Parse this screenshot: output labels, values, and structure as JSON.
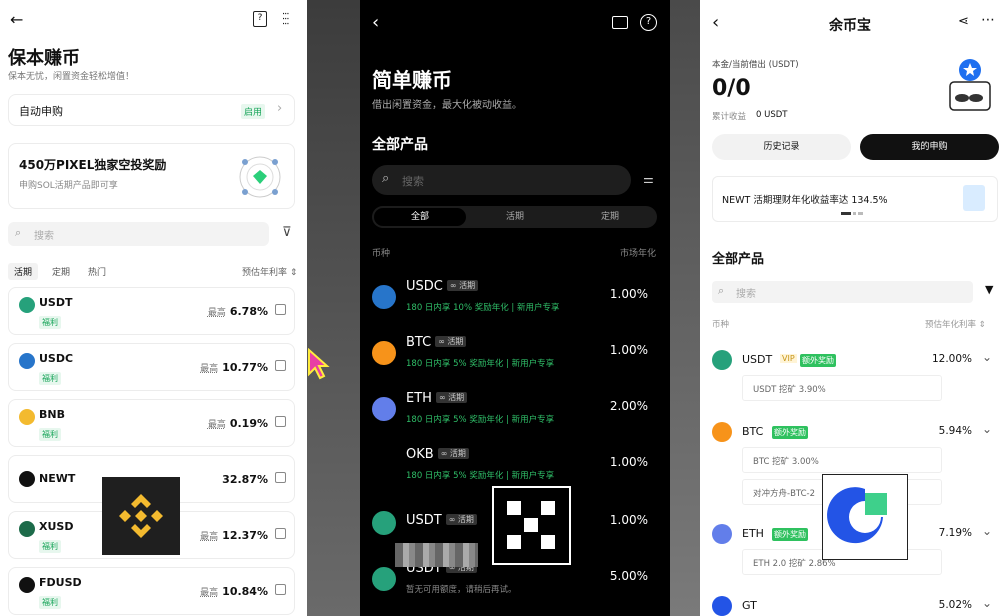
{
  "binance": {
    "title": "保本赚币",
    "subtitle": "保本无忧，闲置资金轻松增值！",
    "auto_subscribe": {
      "label": "自动申购",
      "status": "启用"
    },
    "promo": {
      "title": "450万PIXEL独家空投奖励",
      "desc": "申购SOL活期产品即可享"
    },
    "search_placeholder": "搜索",
    "tabs": [
      "活期",
      "定期",
      "热门"
    ],
    "sort_label": "预估年利率 ⇕",
    "rows": [
      {
        "symbol": "USDT",
        "tag": "福利",
        "prefix": "最高",
        "rate": "6.78%",
        "color": "#26a17b",
        "icon": "usdt-coin-icon"
      },
      {
        "symbol": "USDC",
        "tag": "福利",
        "prefix": "最高",
        "rate": "10.77%",
        "color": "#2775ca",
        "icon": "usdc-coin-icon"
      },
      {
        "symbol": "BNB",
        "tag": "福利",
        "prefix": "最高",
        "rate": "0.19%",
        "color": "#f3ba2f",
        "icon": "bnb-coin-icon"
      },
      {
        "symbol": "NEWT",
        "tag": "",
        "prefix": "",
        "rate": "32.87%",
        "color": "#111111",
        "icon": "newt-coin-icon"
      },
      {
        "symbol": "XUSD",
        "tag": "福利",
        "prefix": "最高",
        "rate": "12.37%",
        "color": "#1d6b4a",
        "icon": "xusd-coin-icon"
      },
      {
        "symbol": "FDUSD",
        "tag": "福利",
        "prefix": "最高",
        "rate": "10.84%",
        "color": "#111111",
        "icon": "fdusd-coin-icon"
      }
    ]
  },
  "okx": {
    "title": "简单赚币",
    "subtitle": "借出闲置资金，最大化被动收益。",
    "section": "全部产品",
    "search_placeholder": "搜索",
    "tabs": [
      "全部",
      "活期",
      "定期"
    ],
    "col_left": "币种",
    "col_right": "市场年化",
    "rows": [
      {
        "symbol": "USDC",
        "tag": "∞ 活期",
        "sub": "180 日内享 10% 奖励年化 | 新用户专享",
        "rate": "1.00%",
        "color": "#2775ca",
        "icon": "usdc-coin-icon"
      },
      {
        "symbol": "BTC",
        "tag": "∞ 活期",
        "sub": "180 日内享 5% 奖励年化 | 新用户专享",
        "rate": "1.00%",
        "color": "#f7931a",
        "icon": "btc-coin-icon"
      },
      {
        "symbol": "ETH",
        "tag": "∞ 活期",
        "sub": "180 日内享 5% 奖励年化 | 新用户专享",
        "rate": "2.00%",
        "color": "#627eea",
        "icon": "eth-coin-icon"
      },
      {
        "symbol": "OKB",
        "tag": "∞ 活期",
        "sub": "180 日内享 5% 奖励年化 | 新用户专享",
        "rate": "1.00%",
        "color": "#000000",
        "icon": "okb-coin-icon"
      },
      {
        "symbol": "USDT",
        "tag": "∞ 活期",
        "sub": "",
        "rate": "1.00%",
        "color": "#26a17b",
        "icon": "usdt-coin-icon"
      },
      {
        "symbol": "USDT",
        "tag": "∞ 活期",
        "sub": "暂无可用额度，请稍后再试。",
        "rate": "5.00%",
        "color": "#26a17b",
        "icon": "usdt-coin-icon"
      }
    ]
  },
  "gate": {
    "title": "余币宝",
    "principal_label": "本金/当前借出 (USDT)",
    "principal_value": "0/0",
    "earn_label": "累计收益",
    "earn_value": "0 USDT",
    "history_btn": "历史记录",
    "mine_btn": "我的申购",
    "banner": "NEWT 活期理财年化收益率达 134.5%",
    "section": "全部产品",
    "search_placeholder": "搜索",
    "col_left": "币种",
    "col_right": "预估年化利率 ⇕",
    "rows": [
      {
        "symbol": "USDT",
        "vip": "VIP",
        "tag": "额外奖励",
        "rate": "12.00%",
        "color": "#26a17b",
        "icon": "usdt-coin-icon",
        "subs": [
          "USDT 挖矿 3.90%"
        ]
      },
      {
        "symbol": "BTC",
        "vip": "",
        "tag": "额外奖励",
        "rate": "5.94%",
        "color": "#f7931a",
        "icon": "btc-coin-icon",
        "subs": [
          "BTC 挖矿 3.00%",
          "对冲方舟-BTC-2"
        ]
      },
      {
        "symbol": "ETH",
        "vip": "",
        "tag": "额外奖励",
        "rate": "7.19%",
        "color": "#627eea",
        "icon": "eth-coin-icon",
        "subs": [
          "ETH 2.0 挖矿 2.86%"
        ]
      },
      {
        "symbol": "GT",
        "vip": "",
        "tag": "",
        "rate": "5.02%",
        "color": "#2354e6",
        "icon": "gt-coin-icon",
        "subs": []
      }
    ]
  }
}
